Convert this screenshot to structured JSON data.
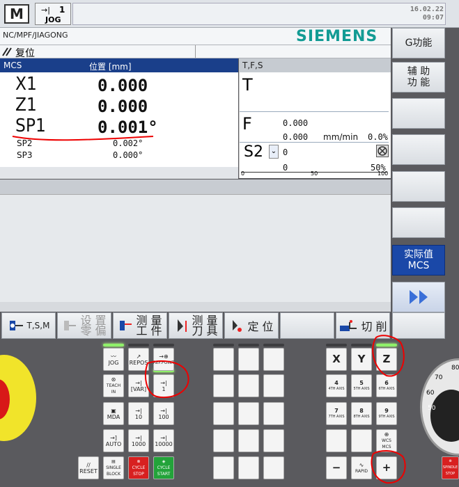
{
  "header": {
    "mode_icon": "M",
    "mode_symbol": "→|",
    "mode_step": "1",
    "mode_label": "JOG",
    "date": "16.02.22",
    "time": "09:07"
  },
  "path": "NC/MPF/JIAGONG",
  "brand": "SIEMENS",
  "reset_label": "复位",
  "mcs": {
    "title": "MCS",
    "pos_label": "位置 [mm]",
    "axes": [
      {
        "name": "X1",
        "value": "0.000"
      },
      {
        "name": "Z1",
        "value": "0.000"
      },
      {
        "name": "SP1",
        "value": "0.001°"
      },
      {
        "name": "SP2",
        "value": "0.002°"
      },
      {
        "name": "SP3",
        "value": "0.000°"
      }
    ]
  },
  "tfs": {
    "title": "T,F,S",
    "t_label": "T",
    "f_label": "F",
    "f_value1": "0.000",
    "f_value2": "0.000",
    "f_unit": "mm/min",
    "f_pct": "0.0%",
    "s_label": "S2",
    "s_value1": "0",
    "s_value2": "0",
    "s_pct": "50%",
    "scale": [
      "0",
      "50",
      "100"
    ]
  },
  "softkeys_right": [
    "G功能",
    "辅 助\n功 能",
    "",
    "",
    "",
    "",
    "实际值\nMCS",
    ""
  ],
  "softkeys_bottom": [
    {
      "label": "T,S,M"
    },
    {
      "label": "设 置\n零 偏",
      "disabled": true
    },
    {
      "label": "测 量\n工 件"
    },
    {
      "label": "测 量\n刀 具"
    },
    {
      "label": "定 位"
    },
    {
      "label": ""
    },
    {
      "label": "切 削"
    },
    {
      "label": ""
    }
  ],
  "keys": {
    "jog": "JOG",
    "repos": "REPOS",
    "refpoint": "REF.POINT",
    "teachin": "TEACH IN",
    "var": "[VAR]",
    "inc1": "1",
    "mda": "MDA",
    "inc10": "10",
    "inc100": "100",
    "auto": "AUTO",
    "inc1000": "1000",
    "inc10000": "10000",
    "reset": "RESET",
    "single": "SINGLE BLOCK",
    "cstop": "CYCLE STOP",
    "cstart": "CYCLE START",
    "x": "X",
    "y": "Y",
    "z": "Z",
    "a4": "4",
    "a4s": "4TH AXIS",
    "a5": "5",
    "a5s": "5TH AXIS",
    "a6": "6",
    "a6s": "6TH AXIS",
    "a7": "7",
    "a7s": "7TH AXIS",
    "a8": "8",
    "a8s": "8TH AXIS",
    "a9": "9",
    "a9s": "9TH AXIS",
    "wcs": "WCS MCS",
    "minus": "−",
    "rapid": "RAPID",
    "plus": "+",
    "spstop": "SPINDLE STOP",
    "dial": [
      "70",
      "80",
      "60",
      "50"
    ]
  }
}
